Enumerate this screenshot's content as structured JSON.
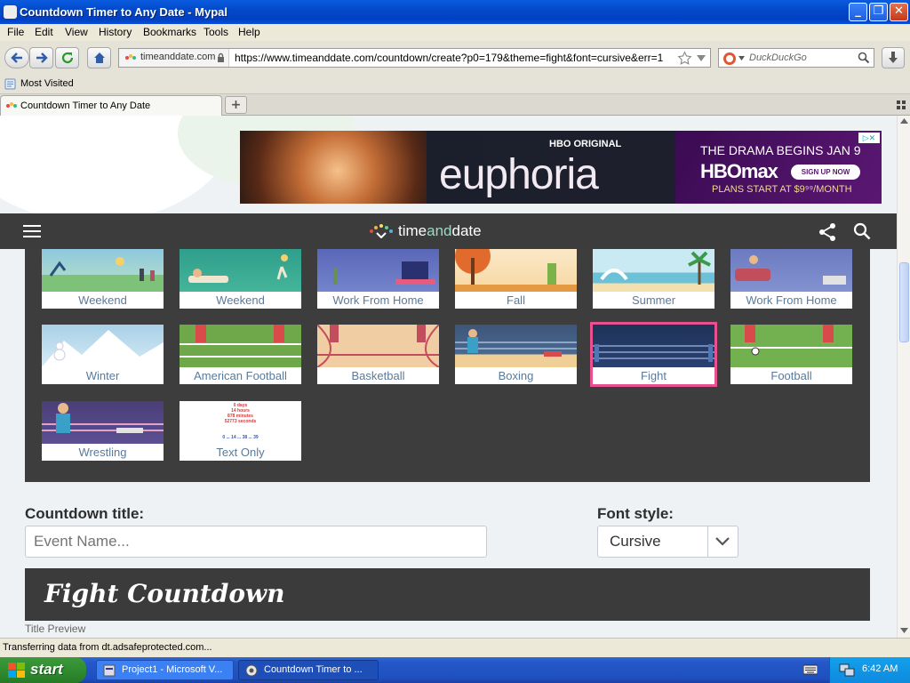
{
  "window": {
    "title": "Countdown Timer to Any Date - Mypal"
  },
  "menu": {
    "items": [
      "File",
      "Edit",
      "View",
      "History",
      "Bookmarks",
      "Tools",
      "Help"
    ]
  },
  "nav": {
    "identity": "timeanddate.com",
    "url": "https://www.timeanddate.com/countdown/create?p0=179&theme=fight&font=cursive&err=1",
    "search_placeholder": "DuckDuckGo"
  },
  "bookmarks": {
    "most_visited": "Most Visited"
  },
  "tabs": [
    {
      "label": "Countdown Timer to Any Date"
    }
  ],
  "ad": {
    "network": "HBO ORIGINAL",
    "show": "euphoria",
    "headline": "THE DRAMA BEGINS JAN 9",
    "brand": "HBOmax",
    "cta": "SIGN UP NOW",
    "price": "PLANS START AT $9⁹⁹/MONTH"
  },
  "site": {
    "logo_a": "time",
    "logo_b": "and",
    "logo_c": "date"
  },
  "themes": [
    {
      "label": "Weekend",
      "selected": false
    },
    {
      "label": "Weekend",
      "selected": false
    },
    {
      "label": "Work From Home",
      "selected": false
    },
    {
      "label": "Fall",
      "selected": false
    },
    {
      "label": "Summer",
      "selected": false
    },
    {
      "label": "Work From Home",
      "selected": false
    },
    {
      "label": "Winter",
      "selected": false
    },
    {
      "label": "American Football",
      "selected": false
    },
    {
      "label": "Basketball",
      "selected": false
    },
    {
      "label": "Boxing",
      "selected": false
    },
    {
      "label": "Fight",
      "selected": true
    },
    {
      "label": "Football",
      "selected": false
    },
    {
      "label": "Wrestling",
      "selected": false
    },
    {
      "label": "Text Only",
      "selected": false
    }
  ],
  "text_only_preview": [
    "0 days",
    "14 hours",
    "878 minutes",
    "52773 seconds",
    "0 ... 14 ... 38 ... 39"
  ],
  "form": {
    "title_label": "Countdown title:",
    "title_placeholder": "Event Name...",
    "font_label": "Font style:",
    "font_value": "Cursive"
  },
  "preview": {
    "text": "Fight Countdown",
    "caption": "Title Preview"
  },
  "status": {
    "text": "Transferring data from dt.adsafeprotected.com..."
  },
  "taskbar": {
    "start": "start",
    "tasks": [
      "Project1 - Microsoft V...",
      "Countdown Timer to ..."
    ],
    "clock": "6:42 AM"
  },
  "colors": {
    "selected_border": "#e8508f",
    "panel": "#3d3d3d",
    "title_bar": "#0349c9"
  }
}
